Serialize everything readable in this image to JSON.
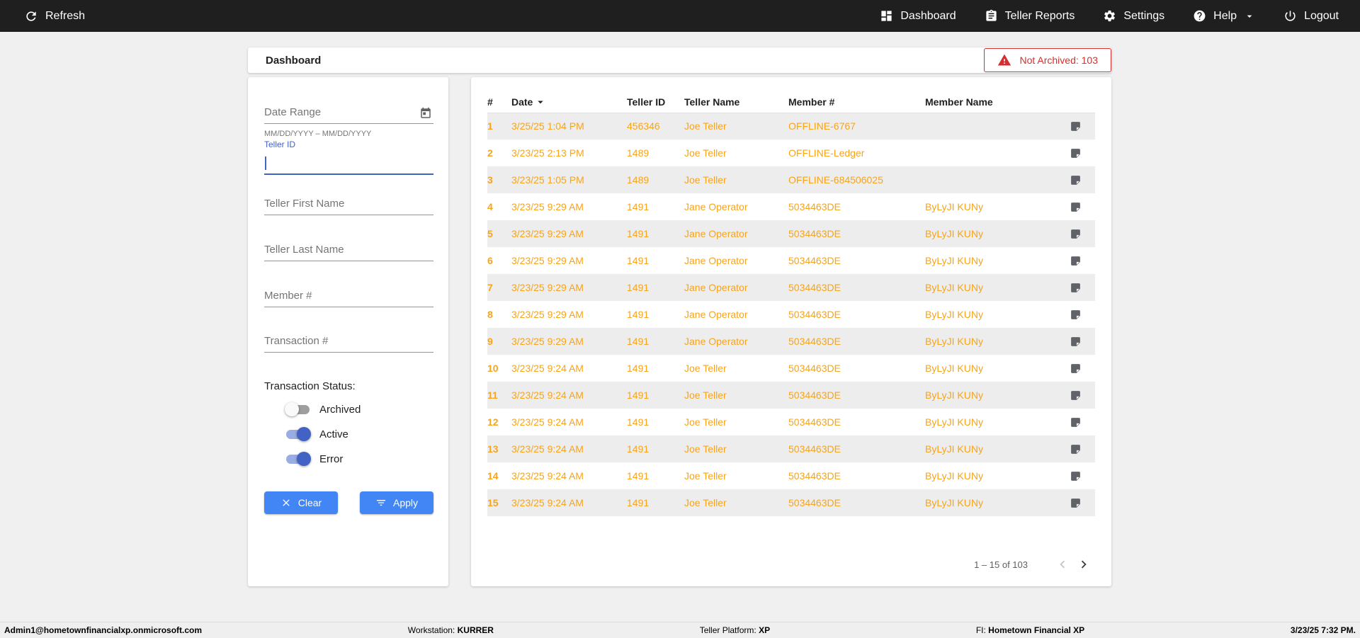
{
  "topbar": {
    "refresh_label": "Refresh",
    "nav": [
      {
        "label": "Dashboard"
      },
      {
        "label": "Teller Reports"
      },
      {
        "label": "Settings"
      },
      {
        "label": "Help"
      },
      {
        "label": "Logout"
      }
    ]
  },
  "header": {
    "title": "Dashboard",
    "not_archived": "Not Archived: 103"
  },
  "filters": {
    "date_range_placeholder": "Date Range",
    "date_range_hint": "MM/DD/YYYY – MM/DD/YYYY",
    "teller_id_label": "Teller ID",
    "teller_first_name_placeholder": "Teller First Name",
    "teller_last_name_placeholder": "Teller Last Name",
    "member_number_placeholder": "Member #",
    "transaction_number_placeholder": "Transaction #",
    "transaction_status_label": "Transaction Status:",
    "toggles": [
      {
        "label": "Archived",
        "on": false
      },
      {
        "label": "Active",
        "on": true
      },
      {
        "label": "Error",
        "on": true
      }
    ],
    "clear_button": "Clear",
    "apply_button": "Apply"
  },
  "table": {
    "columns": [
      "#",
      "Date",
      "Teller ID",
      "Teller Name",
      "Member #",
      "Member Name"
    ],
    "rows": [
      {
        "num": "1",
        "date": "3/25/25 1:04 PM",
        "teller_id": "456346",
        "teller_name": "Joe Teller",
        "member_num": "OFFLINE-6767",
        "member_name": ""
      },
      {
        "num": "2",
        "date": "3/23/25 2:13 PM",
        "teller_id": "1489",
        "teller_name": "Joe Teller",
        "member_num": "OFFLINE-Ledger",
        "member_name": ""
      },
      {
        "num": "3",
        "date": "3/23/25 1:05 PM",
        "teller_id": "1489",
        "teller_name": "Joe Teller",
        "member_num": "OFFLINE-684506025",
        "member_name": ""
      },
      {
        "num": "4",
        "date": "3/23/25 9:29 AM",
        "teller_id": "1491",
        "teller_name": "Jane Operator",
        "member_num": "5034463DE",
        "member_name": "ByLyJI KUNy"
      },
      {
        "num": "5",
        "date": "3/23/25 9:29 AM",
        "teller_id": "1491",
        "teller_name": "Jane Operator",
        "member_num": "5034463DE",
        "member_name": "ByLyJI KUNy"
      },
      {
        "num": "6",
        "date": "3/23/25 9:29 AM",
        "teller_id": "1491",
        "teller_name": "Jane Operator",
        "member_num": "5034463DE",
        "member_name": "ByLyJI KUNy"
      },
      {
        "num": "7",
        "date": "3/23/25 9:29 AM",
        "teller_id": "1491",
        "teller_name": "Jane Operator",
        "member_num": "5034463DE",
        "member_name": "ByLyJI KUNy"
      },
      {
        "num": "8",
        "date": "3/23/25 9:29 AM",
        "teller_id": "1491",
        "teller_name": "Jane Operator",
        "member_num": "5034463DE",
        "member_name": "ByLyJI KUNy"
      },
      {
        "num": "9",
        "date": "3/23/25 9:29 AM",
        "teller_id": "1491",
        "teller_name": "Jane Operator",
        "member_num": "5034463DE",
        "member_name": "ByLyJI KUNy"
      },
      {
        "num": "10",
        "date": "3/23/25 9:24 AM",
        "teller_id": "1491",
        "teller_name": "Joe Teller",
        "member_num": "5034463DE",
        "member_name": "ByLyJI KUNy"
      },
      {
        "num": "11",
        "date": "3/23/25 9:24 AM",
        "teller_id": "1491",
        "teller_name": "Joe Teller",
        "member_num": "5034463DE",
        "member_name": "ByLyJI KUNy"
      },
      {
        "num": "12",
        "date": "3/23/25 9:24 AM",
        "teller_id": "1491",
        "teller_name": "Joe Teller",
        "member_num": "5034463DE",
        "member_name": "ByLyJI KUNy"
      },
      {
        "num": "13",
        "date": "3/23/25 9:24 AM",
        "teller_id": "1491",
        "teller_name": "Joe Teller",
        "member_num": "5034463DE",
        "member_name": "ByLyJI KUNy"
      },
      {
        "num": "14",
        "date": "3/23/25 9:24 AM",
        "teller_id": "1491",
        "teller_name": "Joe Teller",
        "member_num": "5034463DE",
        "member_name": "ByLyJI KUNy"
      },
      {
        "num": "15",
        "date": "3/23/25 9:24 AM",
        "teller_id": "1491",
        "teller_name": "Joe Teller",
        "member_num": "5034463DE",
        "member_name": "ByLyJI KUNy"
      }
    ],
    "pagination": {
      "range_text": "1 – 15 of 103"
    }
  },
  "footer": {
    "user": "Admin1@hometownfinancialxp.onmicrosoft.com",
    "workstation_label": "Workstation:",
    "workstation_value": "KURRER",
    "platform_label": "Teller Platform:",
    "platform_value": "XP",
    "fi_label": "FI:",
    "fi_value": "Hometown Financial XP",
    "datetime": "3/23/25 7:32 PM."
  },
  "colors": {
    "accent_blue": "#4285F4",
    "focus_blue": "#4262C4",
    "row_orange": "#F7A41B",
    "alert_red": "#D32F2F",
    "topbar_bg": "#1F1F1F"
  }
}
